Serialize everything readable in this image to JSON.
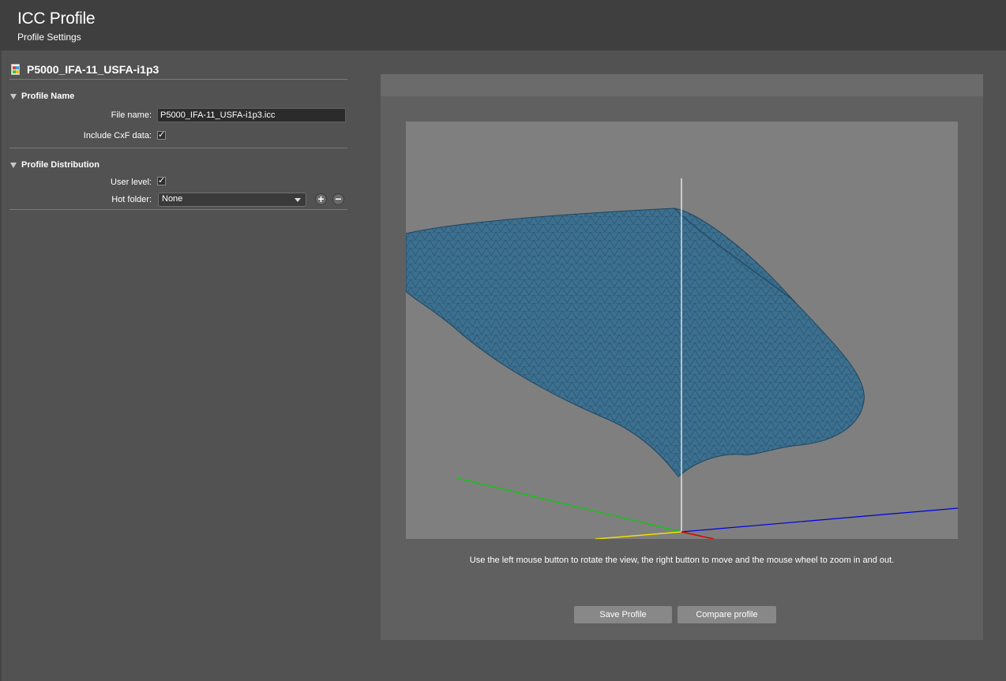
{
  "header": {
    "title": "ICC Profile",
    "subtitle": "Profile Settings"
  },
  "profile": {
    "name": "P5000_IFA-11_USFA-i1p3",
    "icon": "document-icon"
  },
  "sections": {
    "profile_name": {
      "title": "Profile Name",
      "file_name_label": "File name:",
      "file_name_value": "P5000_IFA-11_USFA-i1p3.icc",
      "include_cxf_label": "Include CxF data:",
      "include_cxf_checked": true
    },
    "profile_distribution": {
      "title": "Profile Distribution",
      "user_level_label": "User level:",
      "user_level_checked": true,
      "hot_folder_label": "Hot folder:",
      "hot_folder_value": "None"
    }
  },
  "viewer": {
    "hint": "Use the left mouse button to rotate the view, the right button to move and the mouse wheel to zoom in and out.",
    "mesh_color": "#3d6f8f",
    "background": "#7f7f7f",
    "axis_colors": {
      "vertical": "#ffffff",
      "green": "#00d000",
      "blue": "#0000e0",
      "yellow": "#f0e000",
      "red": "#e00000"
    }
  },
  "buttons": {
    "save_profile": "Save Profile",
    "compare_profile": "Compare profile"
  }
}
